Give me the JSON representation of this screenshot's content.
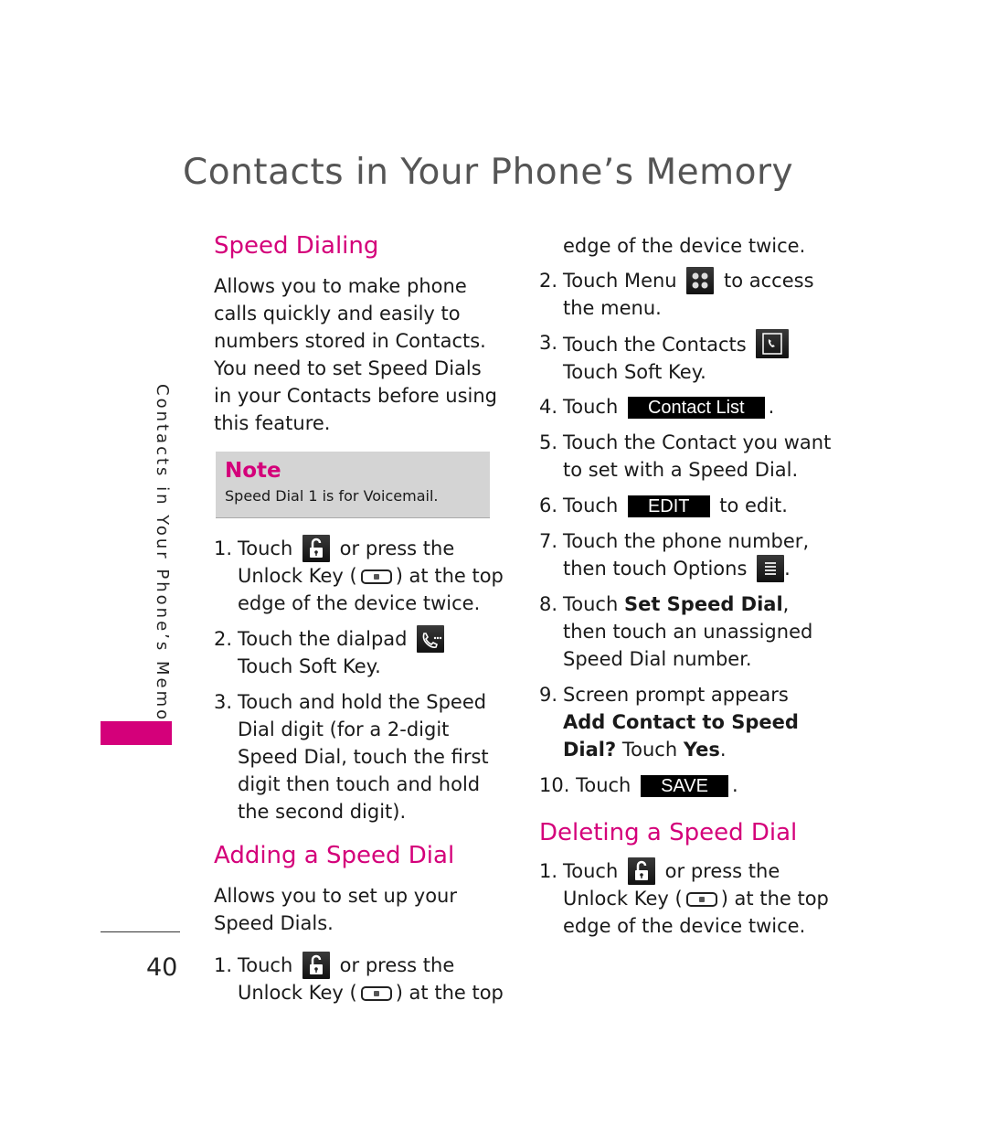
{
  "page": {
    "title": "Contacts in Your Phone’s Memory",
    "side_tab": "Contacts in Your Phone’s Memory",
    "page_number": "40",
    "accent_color": "#d4007a"
  },
  "speed_dialing": {
    "heading": "Speed Dialing",
    "intro": "Allows you to make phone calls quickly and easily to numbers stored in Contacts. You need to set Speed Dials in your Contacts before using this feature.",
    "note": {
      "title": "Note",
      "text": "Speed Dial 1 is for Voicemail."
    },
    "steps": [
      {
        "num": "1.",
        "a": "Touch",
        "b": "or press the Unlock Key (",
        "c": ") at the top edge of the device twice."
      },
      {
        "num": "2.",
        "a": "Touch the dialpad",
        "b": "Touch Soft Key."
      },
      {
        "num": "3.",
        "a": "Touch and hold the Speed Dial digit (for a 2-digit Speed Dial, touch the first digit then touch and hold the second digit)."
      }
    ]
  },
  "adding": {
    "heading": "Adding a Speed Dial",
    "intro": "Allows you to set up your Speed Dials.",
    "steps": [
      {
        "num": "1.",
        "a": "Touch",
        "b": "or press the Unlock Key (",
        "c": ") at the top",
        "cont": "edge of the device twice."
      },
      {
        "num": "2.",
        "a": "Touch Menu",
        "b": "to access the menu."
      },
      {
        "num": "3.",
        "a": "Touch the Contacts",
        "b": "Touch Soft Key."
      },
      {
        "num": "4.",
        "a": "Touch",
        "button": "Contact List",
        "b": "."
      },
      {
        "num": "5.",
        "a": "Touch the Contact you want to set with a Speed Dial."
      },
      {
        "num": "6.",
        "a": "Touch",
        "button": "EDIT",
        "b": "to edit."
      },
      {
        "num": "7.",
        "a": "Touch the phone number, then touch Options",
        "b": "."
      },
      {
        "num": "8.",
        "a": "Touch",
        "bold": "Set Speed Dial",
        "b": ", then touch an unassigned Speed Dial number."
      },
      {
        "num": "9.",
        "a": "Screen prompt appears",
        "bold": "Add Contact to Speed Dial?",
        "b": "Touch",
        "bold2": "Yes",
        "c": "."
      },
      {
        "num": "10.",
        "a": "Touch",
        "button": "SAVE",
        "b": "."
      }
    ]
  },
  "deleting": {
    "heading": "Deleting a Speed Dial",
    "steps": [
      {
        "num": "1.",
        "a": "Touch",
        "b": "or press the Unlock Key (",
        "c": ") at the top edge of the device twice."
      }
    ]
  },
  "icons": {
    "unlock": "unlock-icon",
    "unlock_key": "unlock-key-icon",
    "dialpad": "dialpad-icon",
    "menu": "menu-icon",
    "contacts": "contacts-icon",
    "options": "options-icon"
  }
}
